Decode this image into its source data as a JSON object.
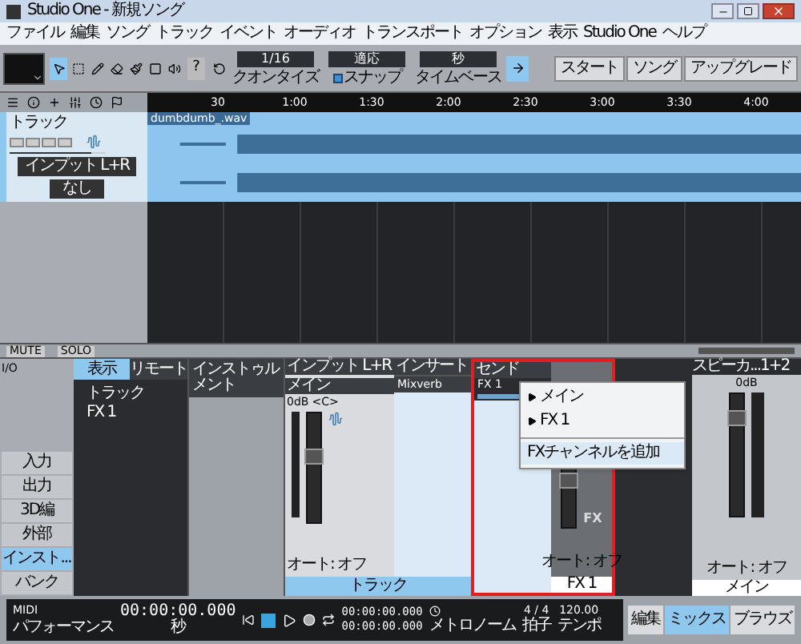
{
  "window": {
    "title": "Studio One - 新規ソング"
  },
  "menu": [
    "ファイル",
    "編集",
    "ソング",
    "トラック",
    "イベント",
    "オーディオ",
    "トランスポート",
    "オプション",
    "表示",
    "Studio One",
    "ヘルプ"
  ],
  "toolbar": {
    "help": "?",
    "fields": [
      {
        "value": "1/16",
        "label": "クオンタイズ"
      },
      {
        "value": "適応",
        "label": "スナップ",
        "checked": true
      },
      {
        "value": "秒",
        "label": "タイムベース"
      }
    ],
    "buttons": [
      "スタート",
      "ソング",
      "アップグレード"
    ]
  },
  "ruler": [
    "30",
    "1:00",
    "1:30",
    "2:00",
    "2:30",
    "3:00",
    "3:30",
    "4:00"
  ],
  "track": {
    "name": "トラック",
    "toggles": [
      {
        "on": false
      },
      {
        "on": false
      },
      {
        "on": false
      },
      {
        "on": false
      }
    ],
    "level": 0.85,
    "input": "インプット L+R",
    "output": "なし",
    "clip": "dumbdumb_.wav"
  },
  "arrange_footer": [
    "MUTE",
    "SOLO"
  ],
  "mixer": {
    "nav_top": "I/O",
    "nav": [
      {
        "label": "入力",
        "selected": false
      },
      {
        "label": "出力",
        "selected": false
      },
      {
        "label": "3D編",
        "selected": false
      },
      {
        "label": "外部",
        "selected": false
      },
      {
        "label": "インスト...",
        "selected": true
      },
      {
        "label": "バンク",
        "selected": false
      }
    ],
    "browser": {
      "tabs": [
        {
          "label": "表示",
          "selected": true
        },
        {
          "label": "リモート",
          "selected": false
        }
      ],
      "items": [
        "トラック",
        "FX 1"
      ]
    },
    "instrument": {
      "title": "インストゥルメント"
    },
    "channel": {
      "input": "インプット L+R",
      "name": "メイン",
      "volume": "0dB",
      "pan": "<C>",
      "level": 0.6,
      "automation": "オート: オフ",
      "label": "トラック"
    },
    "inserts": {
      "title": "インサート",
      "items": [
        "Mixverb"
      ]
    },
    "sends": {
      "title": "センド",
      "items": [
        {
          "label": "FX 1",
          "level": 0.6
        }
      ],
      "menu": [
        {
          "kind": "route",
          "label": "メイン",
          "selected": false
        },
        {
          "kind": "route",
          "label": "FX 1",
          "selected": false
        },
        {
          "kind": "separator"
        },
        {
          "kind": "action",
          "label": "FXチャンネルを追加",
          "selected": true
        }
      ]
    },
    "fx_channel": {
      "tag": "FX",
      "automation": "オート: オフ",
      "label": "FX 1",
      "level": 0.5
    },
    "master": {
      "name": "スピーカ...1+2",
      "volume": "0dB",
      "automation": "オート: オフ",
      "label": "メイン",
      "level": 0.8
    }
  },
  "transport": {
    "midi": "MIDI",
    "performance": "パフォーマンス",
    "time": "00:00:00.000",
    "time_unit": "秒",
    "locators": [
      "00:00:00.000",
      "00:00:00.000"
    ],
    "metronome": "メトロノーム",
    "signature": "4 / 4",
    "signature_label": "拍子",
    "tempo": "120.00",
    "tempo_label": "テンポ"
  },
  "views": [
    {
      "label": "編集",
      "selected": false
    },
    {
      "label": "ミックス",
      "selected": true
    },
    {
      "label": "ブラウズ",
      "selected": false
    }
  ]
}
